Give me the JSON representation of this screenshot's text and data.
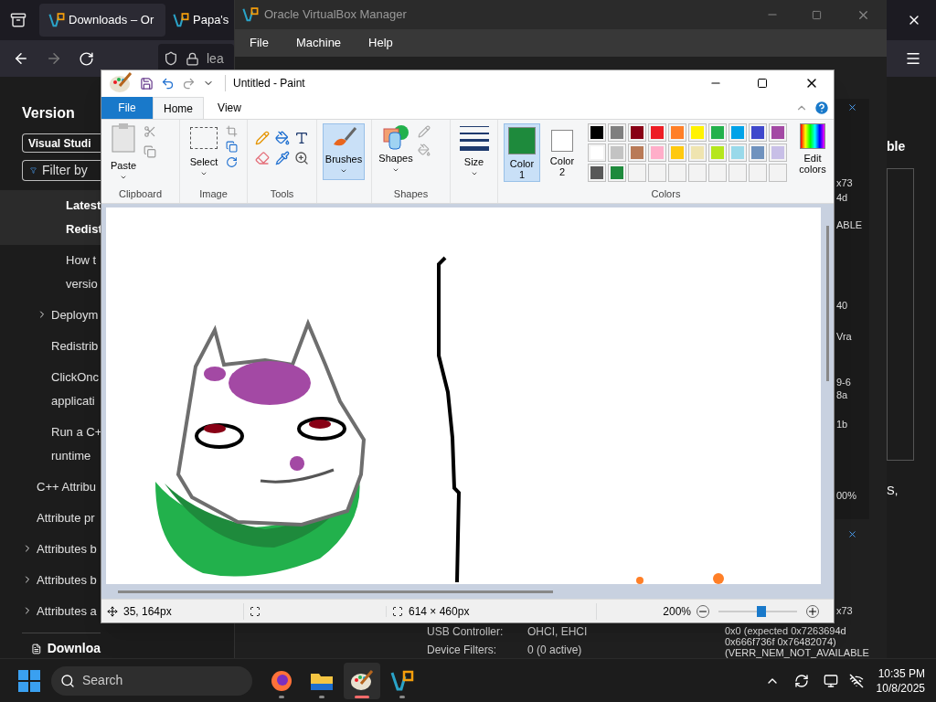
{
  "browser": {
    "tabs": [
      {
        "label": "Downloads – Or",
        "selected": true
      },
      {
        "label": "Papa's",
        "selected": false
      }
    ],
    "address": "lea",
    "sidebar": {
      "heading": "Version",
      "version_button": "Visual Studi",
      "filter_placeholder": "Filter by",
      "tree": [
        {
          "children": [
            {
              "children": [
                {
                  "text": "Latest\nRedist",
                  "selected": true
                },
                {
                  "text": "How t\nversio",
                  "selected": false
                }
              ]
            },
            {
              "text": "Deploym",
              "expanded": false,
              "selected": false
            },
            {
              "text": "Redistrib",
              "selected": false
            },
            {
              "text": "ClickOnc\napplicati",
              "selected": false
            },
            {
              "text": "Run a C+\nruntime",
              "selected": false
            }
          ]
        },
        {
          "text": "C++ Attribu",
          "selected": false
        },
        {
          "text": "Attribute pr",
          "selected": false
        },
        {
          "text": "Attributes b",
          "expanded": false,
          "selected": false
        },
        {
          "text": "Attributes b",
          "expanded": false,
          "selected": false
        },
        {
          "text": "Attributes a",
          "expanded": false,
          "selected": false
        }
      ],
      "download_link": "Downloa"
    },
    "right_texts": [
      "ble",
      "S,"
    ]
  },
  "virtualbox": {
    "title": "Oracle VirtualBox Manager",
    "menu": [
      "File",
      "Machine",
      "Help"
    ],
    "details": [
      {
        "label": "USB Controller:",
        "value": "OHCI, EHCI"
      },
      {
        "label": "Device Filters:",
        "value": "0 (0 active)"
      }
    ],
    "notice_fragments": [
      "x73",
      "4d",
      "ABLE",
      "40",
      "Vra",
      "9-6",
      "8a",
      "1b",
      "00%"
    ],
    "notice2_lines": [
      "x73",
      "0x0 (expected 0x7263694d",
      "0x666f736f 0x76482074)",
      "(VERR_NEM_NOT_AVAILABLE"
    ]
  },
  "paint": {
    "title": "Untitled - Paint",
    "tabs": [
      {
        "label": "File",
        "kind": "file",
        "selected": false
      },
      {
        "label": "Home",
        "kind": "tab",
        "selected": true
      },
      {
        "label": "View",
        "kind": "tab",
        "selected": false
      }
    ],
    "groups": {
      "clipboard": {
        "label": "Clipboard",
        "paste": "Paste"
      },
      "image": {
        "label": "Image",
        "select": "Select"
      },
      "tools": {
        "label": "Tools"
      },
      "brushes": {
        "label": "Brushes",
        "selected": true
      },
      "shapes": {
        "label": "Shapes",
        "button": "Shapes"
      },
      "size": {
        "label": "Size"
      },
      "colors": {
        "label": "Colors",
        "color1": {
          "label": "Color\n1",
          "color": "#1e8a3c",
          "selected": true
        },
        "color2": {
          "label": "Color\n2",
          "color": "#ffffff",
          "selected": false
        },
        "edit": "Edit\ncolors",
        "palette": [
          {
            "color": "#000000"
          },
          {
            "color": "#7f7f7f"
          },
          {
            "color": "#880015"
          },
          {
            "color": "#ed1c24"
          },
          {
            "color": "#ff7f27"
          },
          {
            "color": "#fff200"
          },
          {
            "color": "#22b14c"
          },
          {
            "color": "#00a2e8"
          },
          {
            "color": "#3f48cc"
          },
          {
            "color": "#a349a4"
          },
          {
            "color": "#ffffff"
          },
          {
            "color": "#c3c3c3"
          },
          {
            "color": "#b97a57"
          },
          {
            "color": "#ffaec9"
          },
          {
            "color": "#ffc90e"
          },
          {
            "color": "#efe4b0"
          },
          {
            "color": "#b5e61d"
          },
          {
            "color": "#99d9ea"
          },
          {
            "color": "#7092be"
          },
          {
            "color": "#c8bfe7"
          },
          {
            "color": "#585858"
          },
          {
            "color": "#1e8a3c"
          },
          {
            "kind": "empty"
          },
          {
            "kind": "empty"
          },
          {
            "kind": "empty"
          },
          {
            "kind": "empty"
          },
          {
            "kind": "empty"
          },
          {
            "kind": "empty"
          },
          {
            "kind": "empty"
          },
          {
            "kind": "empty"
          }
        ]
      }
    },
    "status": {
      "position": "35, 164px",
      "canvas_size": "614 × 460px",
      "zoom": "200%",
      "zoom_level": {
        "level": 0.55
      }
    }
  },
  "taskbar": {
    "search_placeholder": "Search",
    "apps": [
      {
        "kind": "firefox",
        "selected": false
      },
      {
        "kind": "explorer",
        "selected": false
      },
      {
        "kind": "paint",
        "selected": true
      },
      {
        "kind": "virtualbox",
        "selected": false
      }
    ],
    "time": "10:35 PM",
    "date": "10/8/2025"
  }
}
